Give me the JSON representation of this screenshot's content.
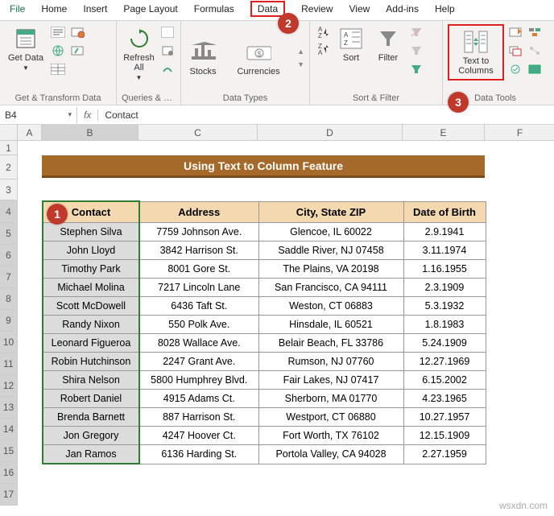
{
  "menu": {
    "file": "File",
    "home": "Home",
    "insert": "Insert",
    "page_layout": "Page Layout",
    "formulas": "Formulas",
    "data": "Data",
    "review": "Review",
    "view": "View",
    "addins": "Add-ins",
    "help": "Help"
  },
  "ribbon": {
    "get_data": "Get Data",
    "get_transform": "Get & Transform Data",
    "refresh_all": "Refresh All",
    "queries": "Queries & Con...",
    "stocks": "Stocks",
    "currencies": "Currencies",
    "data_types": "Data Types",
    "sort": "Sort",
    "filter": "Filter",
    "sort_filter": "Sort & Filter",
    "text_to_columns": "Text to Columns",
    "data_tools": "Data Tools"
  },
  "badges": {
    "b1": "1",
    "b2": "2",
    "b3": "3"
  },
  "namebox": "B4",
  "formula": "Contact",
  "columns": [
    "A",
    "B",
    "C",
    "D",
    "E",
    "F"
  ],
  "row_labels": [
    "1",
    "2",
    "3",
    "4",
    "5",
    "6",
    "7",
    "8",
    "9",
    "10",
    "11",
    "12",
    "13",
    "14",
    "15",
    "16",
    "17"
  ],
  "title": "Using Text to Column Feature",
  "headers": {
    "contact": "Contact",
    "address": "Address",
    "csz": "City, State ZIP",
    "dob": "Date of Birth"
  },
  "rows": [
    {
      "contact": "Stephen Silva",
      "address": "7759 Johnson Ave.",
      "csz": "Glencoe, IL   60022",
      "dob": "2.9.1941"
    },
    {
      "contact": "John Lloyd",
      "address": "3842 Harrison St.",
      "csz": "Saddle River, NJ 07458",
      "dob": "3.11.1974"
    },
    {
      "contact": "Timothy Park",
      "address": "8001 Gore St.",
      "csz": "The Plains, VA   20198",
      "dob": "1.16.1955"
    },
    {
      "contact": "Michael Molina",
      "address": "7217 Lincoln Lane",
      "csz": "San Francisco, CA   94111",
      "dob": "2.3.1909"
    },
    {
      "contact": "Scott McDowell",
      "address": "6436 Taft St.",
      "csz": "Weston, CT   06883",
      "dob": "5.3.1932"
    },
    {
      "contact": "Randy Nixon",
      "address": "550 Polk Ave.",
      "csz": "Hinsdale, IL   60521",
      "dob": "1.8.1983"
    },
    {
      "contact": "Leonard Figueroa",
      "address": "8028 Wallace Ave.",
      "csz": "Belair Beach, FL   33786",
      "dob": "5.24.1909"
    },
    {
      "contact": "Robin Hutchinson",
      "address": "2247 Grant Ave.",
      "csz": "Rumson, NJ   07760",
      "dob": "12.27.1969"
    },
    {
      "contact": "Shira Nelson",
      "address": "5800 Humphrey Blvd.",
      "csz": "Fair Lakes, NJ   07417",
      "dob": "6.15.2002"
    },
    {
      "contact": "Robert Daniel",
      "address": "4915 Adams Ct.",
      "csz": "Sherborn, MA   01770",
      "dob": "4.23.1965"
    },
    {
      "contact": "Brenda Barnett",
      "address": "887 Harrison St.",
      "csz": "Westport, CT   06880",
      "dob": "10.27.1957"
    },
    {
      "contact": "Jon Gregory",
      "address": "4247 Hoover Ct.",
      "csz": "Fort Worth, TX   76102",
      "dob": "12.15.1909"
    },
    {
      "contact": "Jan Ramos",
      "address": "6136 Harding St.",
      "csz": "Portola Valley, CA   94028",
      "dob": "2.27.1959"
    }
  ],
  "watermark": "wsxdn.com"
}
